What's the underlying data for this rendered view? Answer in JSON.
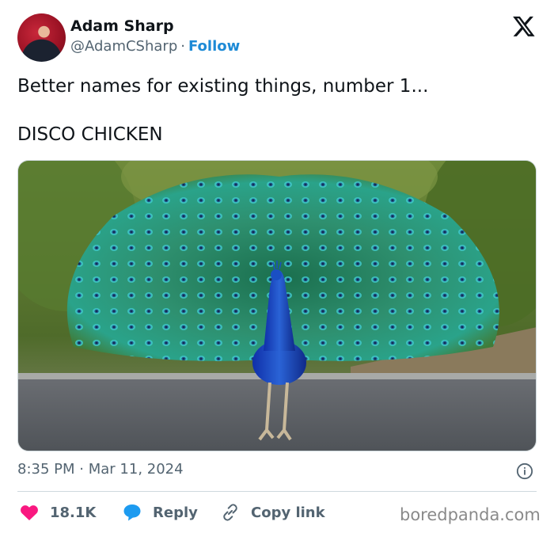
{
  "author": {
    "name": "Adam Sharp",
    "handle": "@AdamCSharp",
    "separator": "·",
    "follow_label": "Follow"
  },
  "tweet": {
    "line1": "Better names for existing things, number 1...",
    "line2": "DISCO CHICKEN"
  },
  "meta": {
    "time": "8:35 PM",
    "separator": "·",
    "date": "Mar 11, 2024"
  },
  "actions": {
    "likes": "18.1K",
    "reply_label": "Reply",
    "copy_label": "Copy link"
  },
  "icons": {
    "platform": "x-logo-icon",
    "info": "info-icon",
    "like": "heart-icon",
    "reply": "speech-bubble-icon",
    "copy": "link-icon"
  },
  "colors": {
    "follow": "#1d8ad6",
    "heart": "#f91880",
    "reply_bubble": "#1d9bf0",
    "secondary_text": "#536471"
  },
  "watermark": "boredpanda.com"
}
